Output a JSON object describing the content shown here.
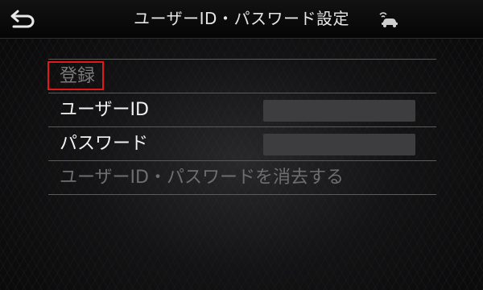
{
  "header": {
    "back_icon": "back-arrow-icon",
    "title": "ユーザーID・パスワード設定",
    "status_icon": "car-network-icon"
  },
  "menu": {
    "register_label": "登録",
    "user_id_label": "ユーザーID",
    "user_id_value": "",
    "password_label": "パスワード",
    "password_value": "",
    "clear_label": "ユーザーID・パスワードを消去する"
  },
  "colors": {
    "focus": "#e01919",
    "field": "#3d3d3f",
    "text": "#f2f2f2",
    "disabled_text": "#6e6e6e",
    "divider": "#5a5a5a"
  }
}
